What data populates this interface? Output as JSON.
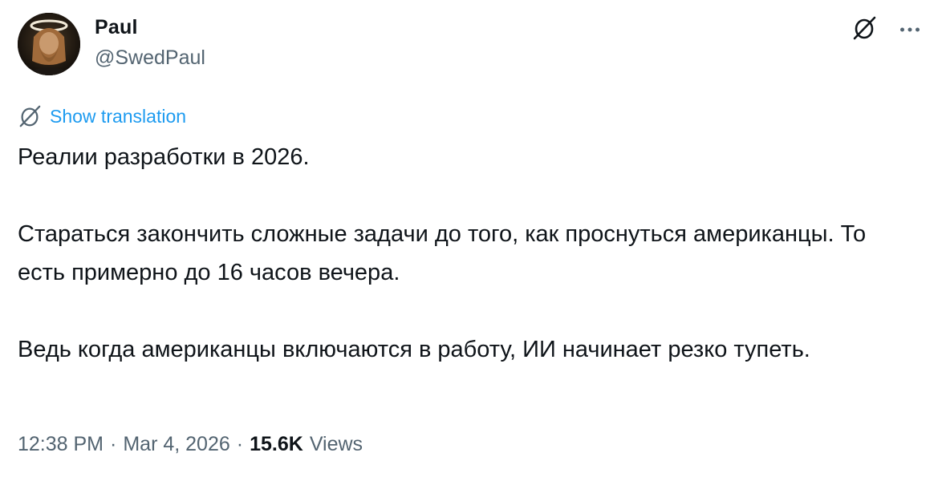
{
  "author": {
    "display_name": "Paul",
    "handle": "@SwedPaul"
  },
  "actions": {
    "grok_icon": "grok-icon",
    "more_icon": "more-icon"
  },
  "translation": {
    "label": "Show translation",
    "icon": "grok-icon"
  },
  "tweet": {
    "paragraphs": [
      "Реалии разработки в 2026.",
      "Стараться закончить сложные задачи до того, как проснуться американцы. То есть примерно до 16 часов вечера.",
      "Ведь когда американцы включаются в работу, ИИ начинает резко тупеть."
    ]
  },
  "meta": {
    "time": "12:38 PM",
    "separator": "·",
    "date": "Mar 4, 2026",
    "views_count": "15.6K",
    "views_label": "Views"
  },
  "colors": {
    "text": "#0f1419",
    "secondary": "#536471",
    "link": "#1d9bf0"
  }
}
